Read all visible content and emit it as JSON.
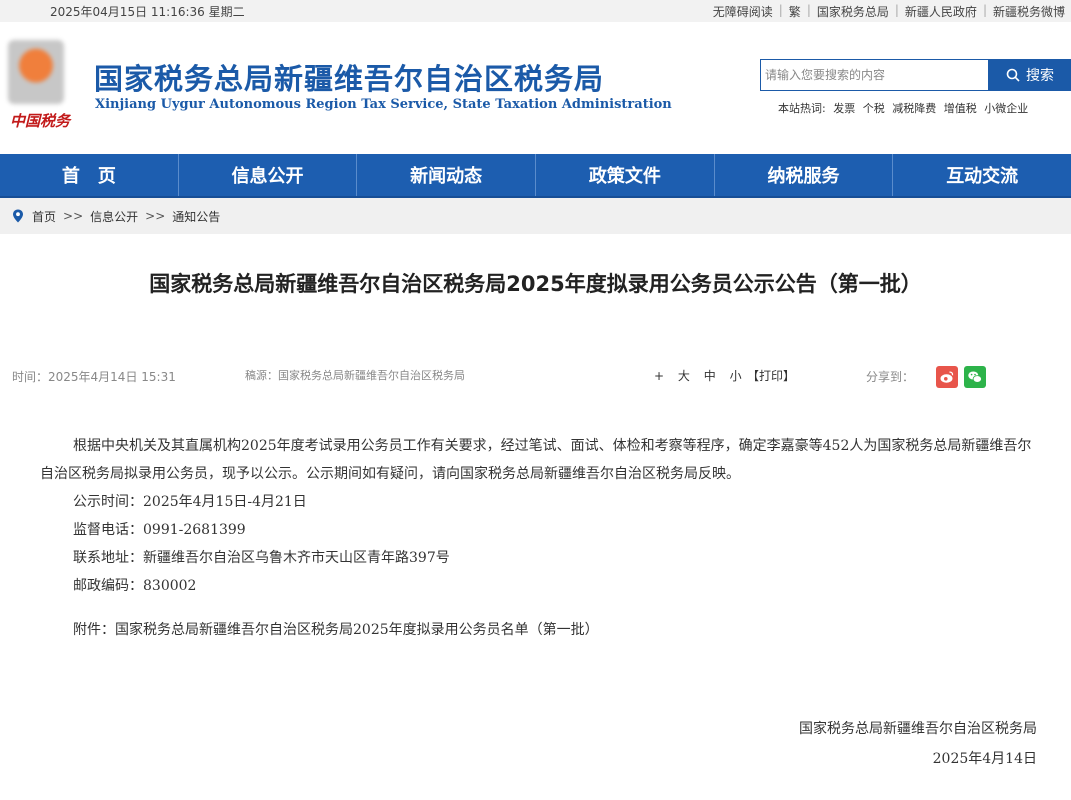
{
  "topbar": {
    "datetime": "2025年04月15日 11:16:36 星期二",
    "links": [
      "无障碍阅读",
      "繁",
      "国家税务总局",
      "新疆人民政府",
      "新疆税务微博"
    ]
  },
  "header": {
    "seal_text": "中国税务",
    "title": "国家税务总局新疆维吾尔自治区税务局",
    "subtitle": "Xinjiang Uygur Autonomous Region Tax Service, State Taxation Administration"
  },
  "search": {
    "placeholder": "请输入您要搜索的内容",
    "button_label": "搜索",
    "hotwords_label": "本站热词:",
    "hotwords": [
      "发票",
      "个税",
      "减税降费",
      "增值税",
      "小微企业"
    ]
  },
  "nav": {
    "items": [
      "首　页",
      "信息公开",
      "新闻动态",
      "政策文件",
      "纳税服务",
      "互动交流"
    ]
  },
  "breadcrumb": {
    "items": [
      "首页",
      "信息公开",
      "通知公告"
    ],
    "separator": ">>"
  },
  "article": {
    "title": "国家税务总局新疆维吾尔自治区税务局2025年度拟录用公务员公示公告（第一批）",
    "time": "时间：2025年4月14日 15:31",
    "source": "稿源：国家税务总局新疆维吾尔自治区税务局",
    "font_controls": [
      "+",
      "大",
      "中",
      "小"
    ],
    "print_label": "【打印】",
    "share_label": "分享到：",
    "paragraph": "根据中央机关及其直属机构2025年度考试录用公务员工作有关要求，经过笔试、面试、体检和考察等程序，确定李嘉豪等452人为国家税务总局新疆维吾尔自治区税务局拟录用公务员，现予以公示。公示期间如有疑问，请向国家税务总局新疆维吾尔自治区税务局反映。",
    "lines": [
      "公示时间：2025年4月15日-4月21日",
      "监督电话：0991-2681399",
      "联系地址：新疆维吾尔自治区乌鲁木齐市天山区青年路397号",
      "邮政编码：830002"
    ],
    "attachment": "附件：国家税务总局新疆维吾尔自治区税务局2025年度拟录用公务员名单（第一批）",
    "signature_org": "国家税务总局新疆维吾尔自治区税务局",
    "signature_date": "2025年4月14日"
  },
  "colors": {
    "brand_blue": "#1b5aa8",
    "nav_blue": "#1d5eb0",
    "weibo_red": "#e8554b",
    "wechat_green": "#2db34a"
  }
}
